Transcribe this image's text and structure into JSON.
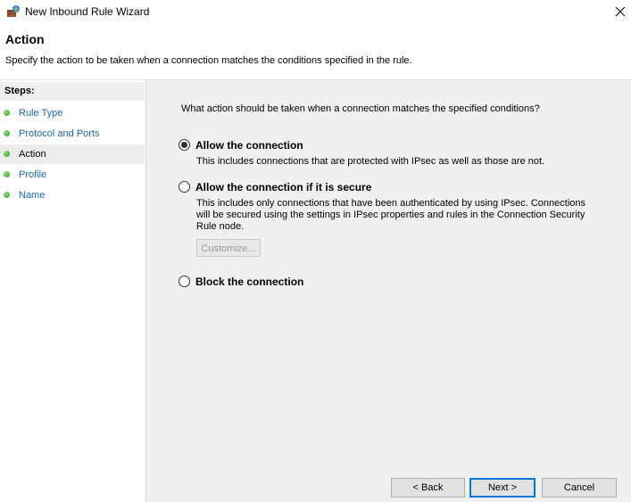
{
  "window": {
    "title": "New Inbound Rule Wizard",
    "close_glyph": "✕"
  },
  "header": {
    "title": "Action",
    "description": "Specify the action to be taken when a connection matches the conditions specified in the rule."
  },
  "sidebar": {
    "steps_label": "Steps:",
    "steps": [
      {
        "label": "Rule Type",
        "active": false
      },
      {
        "label": "Protocol and Ports",
        "active": false
      },
      {
        "label": "Action",
        "active": true
      },
      {
        "label": "Profile",
        "active": false
      },
      {
        "label": "Name",
        "active": false
      }
    ]
  },
  "main": {
    "question": "What action should be taken when a connection matches the specified conditions?",
    "options": [
      {
        "label": "Allow the connection",
        "description": "This includes connections that are protected with IPsec as well as those are not.",
        "selected": true
      },
      {
        "label": "Allow the connection if it is secure",
        "description_lines": [
          "This includes only connections that have been authenticated by using IPsec.  Connections",
          "will be secured using the settings in IPsec properties and rules in the Connection Security",
          "Rule node."
        ],
        "selected": false
      },
      {
        "label": "Block the connection",
        "selected": false
      }
    ],
    "customize_label": "Customize..."
  },
  "buttons": {
    "back": "< Back",
    "next": "Next >",
    "cancel": "Cancel"
  },
  "colors": {
    "link": "#1a67b7",
    "panel_bg": "#f0f0f0",
    "primary_border": "#0078d7"
  }
}
